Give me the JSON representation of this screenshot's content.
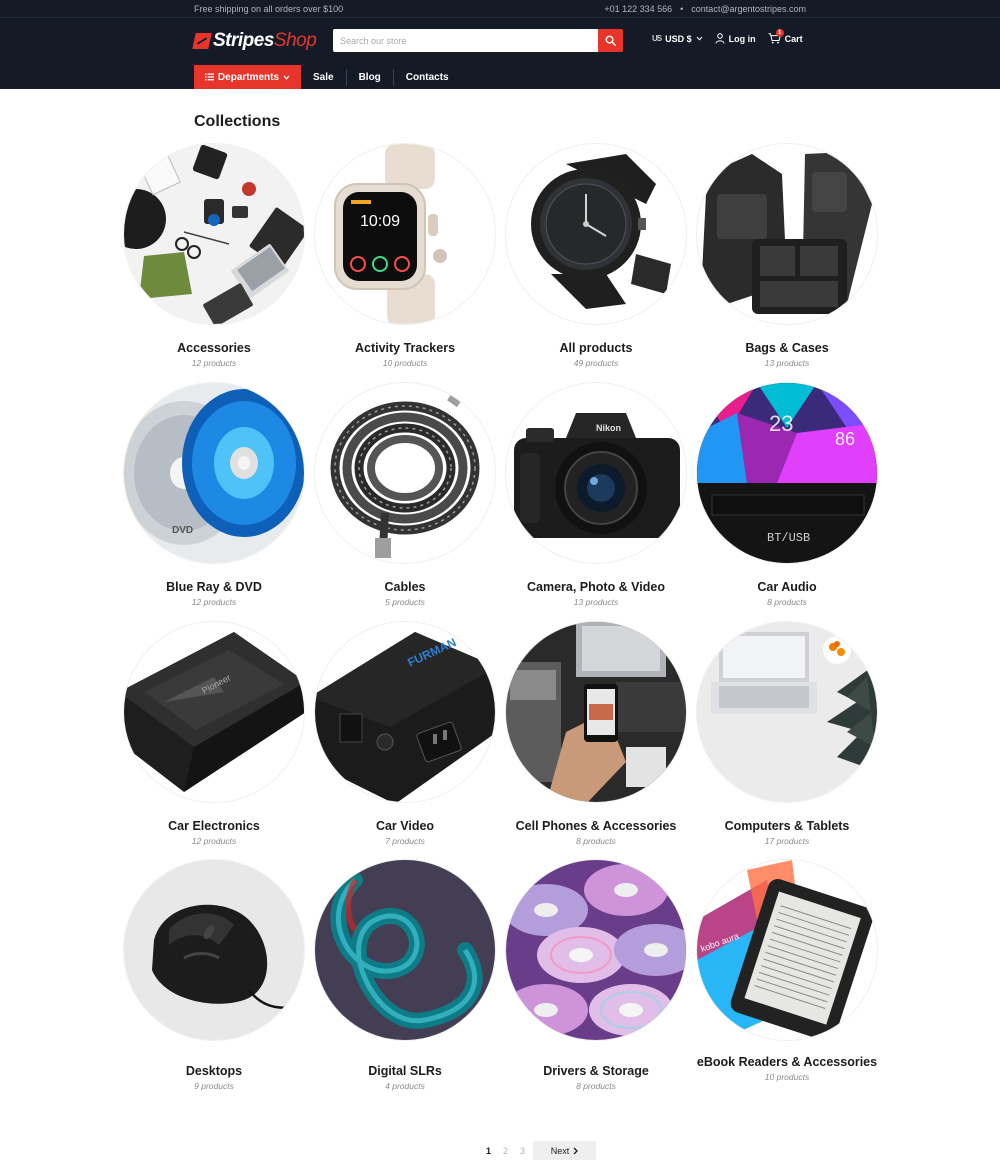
{
  "topbar": {
    "shipping": "Free shipping on all orders over $100",
    "phone": "+01 122 334 566",
    "email": "contact@argentostripes.com"
  },
  "logo": {
    "part1": "Stripes",
    "part2": "Shop"
  },
  "search": {
    "placeholder": "Search our store"
  },
  "header": {
    "flag": "US",
    "currency": "USD $",
    "login": "Log in",
    "cart": "Cart",
    "cart_count": "1"
  },
  "nav": {
    "departments": "Departments",
    "links": [
      "Sale",
      "Blog",
      "Contacts"
    ]
  },
  "page": {
    "title": "Collections"
  },
  "collections": [
    {
      "title": "Accessories",
      "count": "12 products",
      "image": "flat-lay-accessories"
    },
    {
      "title": "Activity Trackers",
      "count": "10 products",
      "image": "smartwatch"
    },
    {
      "title": "All products",
      "count": "49 products",
      "image": "wristwatch"
    },
    {
      "title": "Bags & Cases",
      "count": "13 products",
      "image": "camera-bag"
    },
    {
      "title": "Blue Ray & DVD",
      "count": "12 products",
      "image": "discs"
    },
    {
      "title": "Cables",
      "count": "5 products",
      "image": "hdmi-cable"
    },
    {
      "title": "Camera, Photo & Video",
      "count": "13 products",
      "image": "dslr-camera"
    },
    {
      "title": "Car Audio",
      "count": "8 products",
      "image": "car-stereo"
    },
    {
      "title": "Car Electronics",
      "count": "12 products",
      "image": "car-amplifier"
    },
    {
      "title": "Car Video",
      "count": "7 products",
      "image": "power-conditioner"
    },
    {
      "title": "Cell Phones & Accessories",
      "count": "8 products",
      "image": "phone-in-hand"
    },
    {
      "title": "Computers & Tablets",
      "count": "17 products",
      "image": "laptop-desk"
    },
    {
      "title": "Desktops",
      "count": "9 products",
      "image": "mouse"
    },
    {
      "title": "Digital SLRs",
      "count": "4 products",
      "image": "abstract-loop"
    },
    {
      "title": "Drivers & Storage",
      "count": "8 products",
      "image": "cds-pile"
    },
    {
      "title": "eBook Readers & Accessories",
      "count": "10 products",
      "image": "ereader"
    }
  ],
  "pagination": {
    "pages": [
      "1",
      "2",
      "3"
    ],
    "current": "1",
    "next": "Next"
  },
  "colors": {
    "brand": "#e8352b",
    "header_bg": "#141b27",
    "text": "#1c1c1c",
    "muted": "#8a8a8a"
  }
}
